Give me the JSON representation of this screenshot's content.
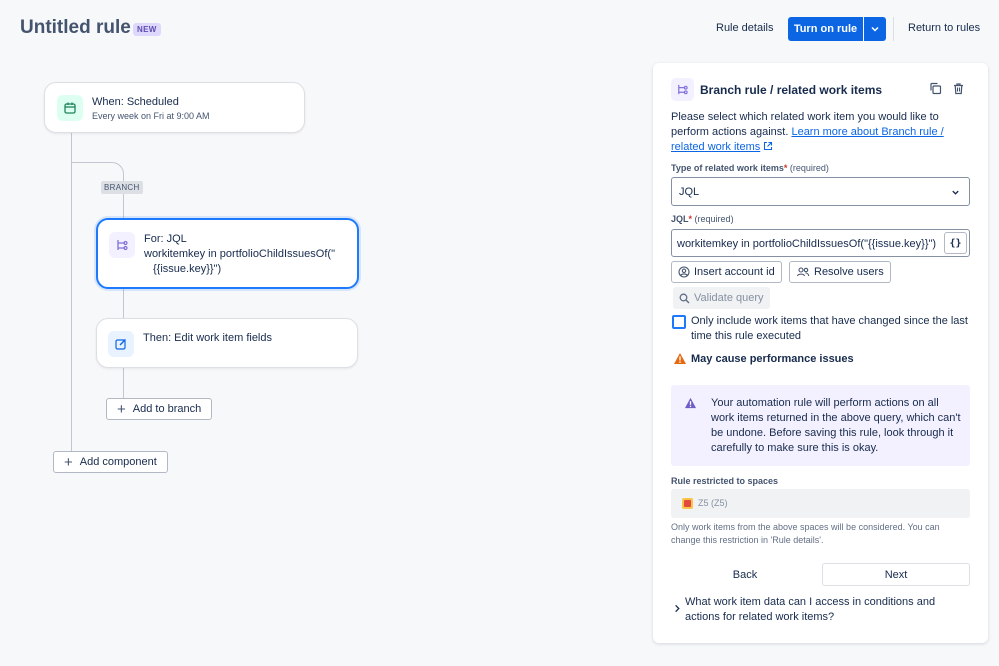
{
  "header": {
    "title": "Untitled rule",
    "badge": "NEW",
    "rule_details": "Rule details",
    "turn_on": "Turn on rule",
    "return": "Return to rules"
  },
  "canvas": {
    "trigger": {
      "title": "When: Scheduled",
      "subtitle": "Every week on Fri at 9:00 AM",
      "icon": "calendar-icon"
    },
    "branch_label": "BRANCH",
    "branch": {
      "title": "For: JQL",
      "line1": "workitemkey in portfolioChildIssuesOf(\"",
      "line2": "{{issue.key}}\")",
      "icon": "branch-icon"
    },
    "action": {
      "title": "Then: Edit work item fields",
      "icon": "edit-icon"
    },
    "add_to_branch": "Add to branch",
    "add_component": "Add component"
  },
  "panel": {
    "title": "Branch rule / related work items",
    "intro": "Please select which related work item you would like to perform actions against.",
    "learn_more": "Learn more about Branch rule / related work items",
    "type_label": "Type of related work items",
    "required_text": "(required)",
    "type_value": "JQL",
    "jql_label": "JQL",
    "jql_value": "workitemkey in portfolioChildIssuesOf(\"{{issue.key}}\")",
    "braces": "{}",
    "insert_account": "Insert account id",
    "resolve_users": "Resolve users",
    "validate": "Validate query",
    "checkbox_label": "Only include work items that have changed since the last time this rule executed",
    "warning": "May cause performance issues",
    "info": "Your automation rule will perform actions on all work items returned in the above query, which can't be undone. Before saving this rule, look through it carefully to make sure this is okay.",
    "spaces_label": "Rule restricted to spaces",
    "space_chip": "Z5 (Z5)",
    "spaces_help": "Only work items from the above spaces will be considered. You can change this restriction in 'Rule details'.",
    "back": "Back",
    "next": "Next",
    "faq": "What work item data can I access in conditions and actions for related work items?"
  },
  "colors": {
    "primary": "#0c66e4",
    "trigger_icon_bg": "#dcfff1",
    "branch_icon_bg": "#f3f0ff",
    "action_icon_bg": "#e9f2ff",
    "warning": "#e56910",
    "discovery": "#6e5dc6"
  }
}
